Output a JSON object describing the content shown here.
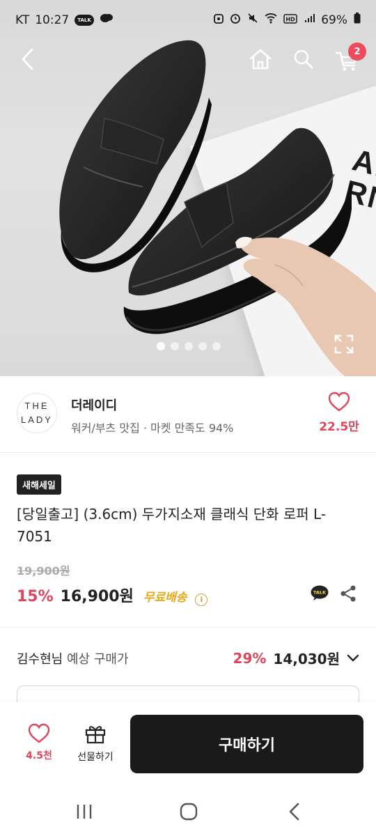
{
  "status_bar": {
    "carrier": "KT",
    "time": "10:27",
    "talk": "TALK",
    "battery": "69%"
  },
  "nav": {
    "cart_count": "2"
  },
  "carousel": {
    "total": 5,
    "active": 1,
    "card_text": "ARRNA"
  },
  "seller": {
    "logo_line1": "THE",
    "logo_line2": "LADY",
    "name": "더레이디",
    "meta": "워커/부츠 맛집 · 마켓 만족도 94%",
    "fav_count": "22.5만"
  },
  "product": {
    "tag": "새해세일",
    "title": "[당일출고] (3.6cm) 두가지소재 클래식 단화 로퍼 L-7051",
    "original_price": "19,900원",
    "discount": "15%",
    "price": "16,900원",
    "shipping": "무료배송",
    "info_icon": "i",
    "talk": "TALK"
  },
  "expected": {
    "user": "김수현님",
    "label": "예상 구매가",
    "rate": "29%",
    "price": "14,030원"
  },
  "bottom": {
    "like_count": "4.5천",
    "gift_label": "선물하기",
    "buy_label": "구매하기"
  },
  "colors": {
    "accent": "#e0455b",
    "shipping": "#e8a816",
    "buy_button": "#1a1a1a"
  }
}
